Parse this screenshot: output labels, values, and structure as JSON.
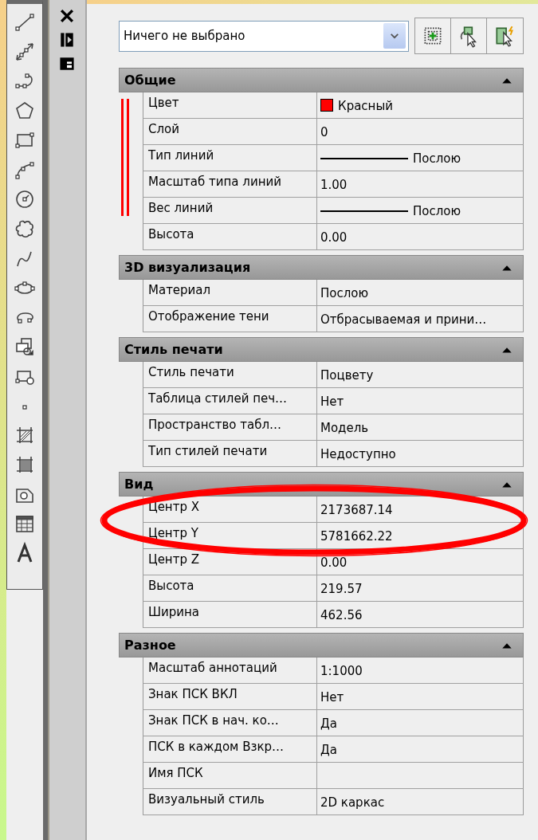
{
  "selector": {
    "value": "Ничего не выбрано"
  },
  "sections": [
    {
      "title": "Общие",
      "expanded": true,
      "rows": [
        {
          "name": "Цвет",
          "kind": "color",
          "value": "Красный",
          "color": "#ff0000",
          "marked": true
        },
        {
          "name": "Слой",
          "kind": "text",
          "value": "0",
          "marked": true
        },
        {
          "name": "Тип линий",
          "kind": "line",
          "value": "Послою",
          "marked": true
        },
        {
          "name": "Масштаб типа линий",
          "kind": "text",
          "value": "1.00",
          "marked": true
        },
        {
          "name": "Вес линий",
          "kind": "line",
          "value": "Послою",
          "marked": true
        },
        {
          "name": "Высота",
          "kind": "text",
          "value": "0.00",
          "marked": false
        }
      ]
    },
    {
      "title": "3D визуализация",
      "expanded": true,
      "rows": [
        {
          "name": "Материал",
          "kind": "text",
          "value": "Послою"
        },
        {
          "name": "Отображение тени",
          "kind": "text",
          "value": "Отбрасываемая и прини…"
        }
      ]
    },
    {
      "title": "Стиль печати",
      "expanded": true,
      "rows": [
        {
          "name": "Стиль печати",
          "kind": "text",
          "value": "Поцвету"
        },
        {
          "name": "Таблица стилей печ…",
          "kind": "text",
          "value": "Нет"
        },
        {
          "name": "Пространство табл…",
          "kind": "text",
          "value": "Модель"
        },
        {
          "name": "Тип стилей печати",
          "kind": "text",
          "value": "Недоступно"
        }
      ]
    },
    {
      "title": "Вид",
      "expanded": true,
      "rows": [
        {
          "name": "Центр X",
          "kind": "text",
          "value": "2173687.14",
          "circled": true
        },
        {
          "name": "Центр Y",
          "kind": "text",
          "value": "5781662.22",
          "circled": true
        },
        {
          "name": "Центр Z",
          "kind": "text",
          "value": "0.00",
          "circled": false
        },
        {
          "name": "Высота",
          "kind": "text",
          "value": "219.57",
          "circled": false
        },
        {
          "name": "Ширина",
          "kind": "text",
          "value": "462.56",
          "circled": false
        }
      ]
    },
    {
      "title": "Разное",
      "expanded": true,
      "rows": [
        {
          "name": "Масштаб аннотаций",
          "kind": "text",
          "value": "1:1000"
        },
        {
          "name": "Знак ПСК ВКЛ",
          "kind": "text",
          "value": "Нет"
        },
        {
          "name": "Знак ПСК в нач. ко…",
          "kind": "text",
          "value": "Да"
        },
        {
          "name": "ПСК в каждом Взкр…",
          "kind": "text",
          "value": "Да"
        },
        {
          "name": "Имя ПСК",
          "kind": "text",
          "value": ""
        },
        {
          "name": "Визуальный стиль",
          "kind": "text",
          "value": "2D каркас"
        }
      ]
    }
  ]
}
